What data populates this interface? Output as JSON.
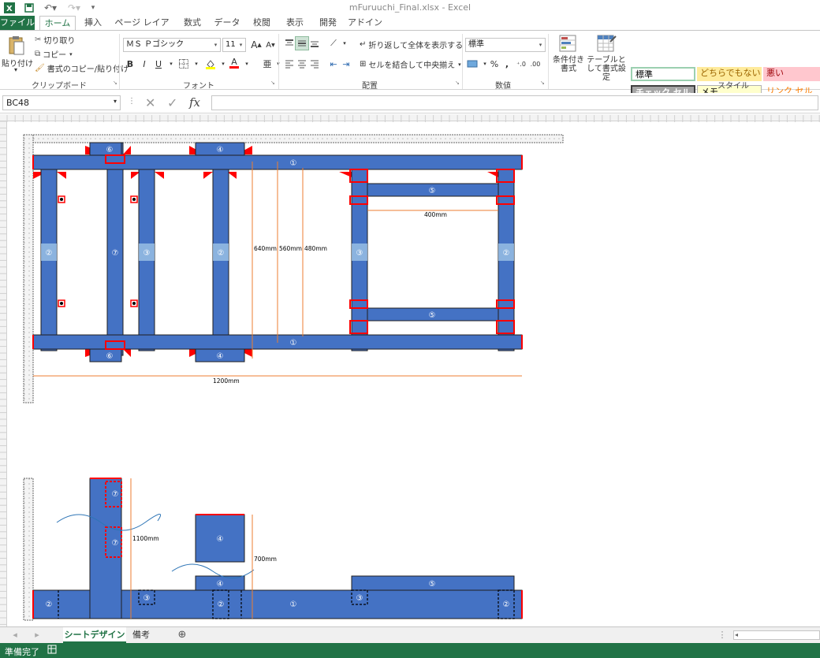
{
  "app": {
    "window_title": "mFuruuchi_Final.xlsx - Excel"
  },
  "ribbon_tabs": [
    {
      "label": "ファイル"
    },
    {
      "label": "ホーム"
    },
    {
      "label": "挿入"
    },
    {
      "label": "ページ レイアウト"
    },
    {
      "label": "数式"
    },
    {
      "label": "データ"
    },
    {
      "label": "校閲"
    },
    {
      "label": "表示"
    },
    {
      "label": "開発"
    },
    {
      "label": "アドイン"
    }
  ],
  "clipboard": {
    "group_label": "クリップボード",
    "paste": "貼り付け",
    "cut": "切り取り",
    "copy": "コピー",
    "format_painter": "書式のコピー/貼り付け"
  },
  "font": {
    "group_label": "フォント",
    "font_name": "ＭＳ Ｐゴシック",
    "font_size": "11",
    "bold": "B",
    "italic": "I",
    "underline": "U",
    "grow": "A",
    "shrink": "A",
    "color_a": "A"
  },
  "alignment": {
    "group_label": "配置",
    "wrap_text": "折り返して全体を表示する",
    "merge_center": "セルを結合して中央揃え"
  },
  "number": {
    "group_label": "数値",
    "format": "標準",
    "percent": "%",
    "comma": ","
  },
  "styles": {
    "group_label": "スタイル",
    "conditional": "条件付き書式",
    "table": "テーブルとして書式設定",
    "cells": [
      {
        "label": "標準"
      },
      {
        "label": "どちらでもない"
      },
      {
        "label": "悪い"
      },
      {
        "label": "チェック セル"
      },
      {
        "label": "メモ"
      },
      {
        "label": "リンク セル"
      }
    ]
  },
  "formula_bar": {
    "name_box": "BC48",
    "value": ""
  },
  "diagram": {
    "beam_labels": {
      "b1": "①",
      "b2": "②",
      "b3": "③",
      "b4": "④",
      "b5": "⑤",
      "b6": "⑥",
      "b7": "⑦"
    },
    "dimensions": {
      "d640": "640mm",
      "d560": "560mm",
      "d480": "480mm",
      "d400": "400mm",
      "d1200": "1200mm",
      "d1100": "1100mm",
      "d700": "700mm"
    },
    "colors": {
      "beam": "#4472C4",
      "edge_red": "#FF0000",
      "dim_orange": "#ED7D31"
    }
  },
  "sheet_tabs": [
    {
      "label": "シートデザイン"
    },
    {
      "label": "備考"
    }
  ],
  "status": {
    "text": "準備完了"
  }
}
